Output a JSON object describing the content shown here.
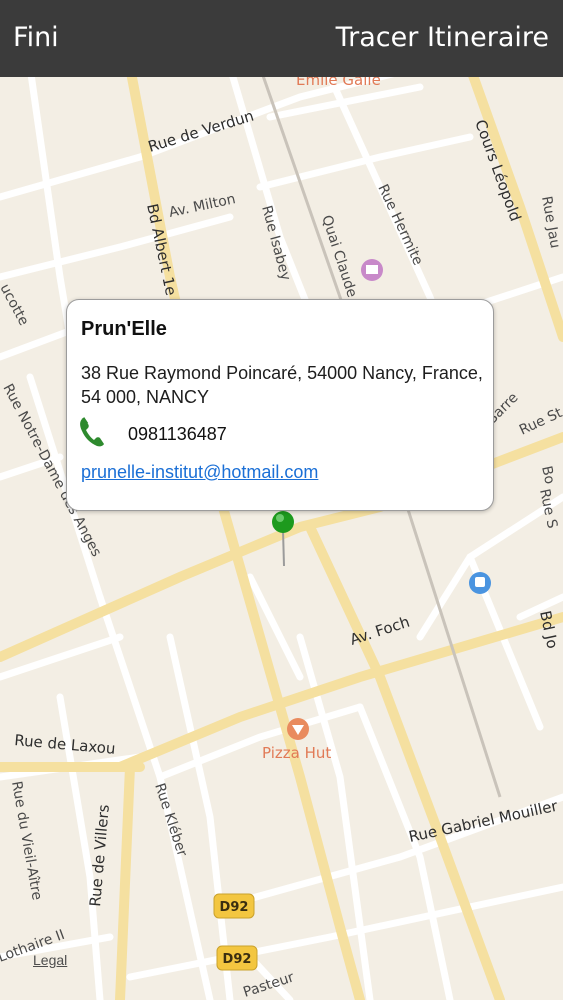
{
  "topbar": {
    "left_button": "Fini",
    "right_button": "Tracer Itineraire"
  },
  "callout": {
    "name": "Prun'Elle",
    "address": "38 Rue Raymond Poincaré, 54000 Nancy, France, 54 000, NANCY",
    "phone": "0981136487",
    "email": "prunelle-institut@hotmail.com",
    "phone_icon": "phone-icon"
  },
  "map": {
    "streets": {
      "rue_de_verdun": "Rue de Verdun",
      "cours_leopold": "Cours Léopold",
      "bd_albert": "Bd Albert 1e",
      "av_milton": "Av. Milton",
      "rue_isabey": "Rue Isabey",
      "quai_claude": "Quai Claude",
      "rue_hermite": "Rue Hermite",
      "rue_jau": "Rue Jau",
      "rue_notre_dame": "Rue Notre-Dame des Anges",
      "rue_de_sarre": "Rue de Sarre",
      "rue_st": "Rue St",
      "av_foch": "Av. Foch",
      "rue_de_laxou": "Rue de Laxou",
      "rue_vieil_aitre": "Rue du Vieil-Aître",
      "rue_de_villers": "Rue de Villers",
      "rue_kleber": "Rue Kléber",
      "rue_gabriel": "Rue Gabriel Mouiller",
      "lothaire": "Lothaire II",
      "pasteur": "Pasteur",
      "bd_jo": "Bd Jo",
      "ruc": "ucotte",
      "rue_bo": "Bo",
      "rue_s": "Rue S"
    },
    "pois": {
      "emile_galle": "Emile Gallé",
      "pizza_hut": "Pizza Hut"
    },
    "road_badges": {
      "d92_a": "D92",
      "d92_b": "D92"
    },
    "legal": "Legal",
    "colors": {
      "background": "#f3eee4",
      "road": "#ffffff",
      "major_road": "#f5e0a0",
      "poi": "#e17a56",
      "pin": "#1d9a1d"
    }
  }
}
